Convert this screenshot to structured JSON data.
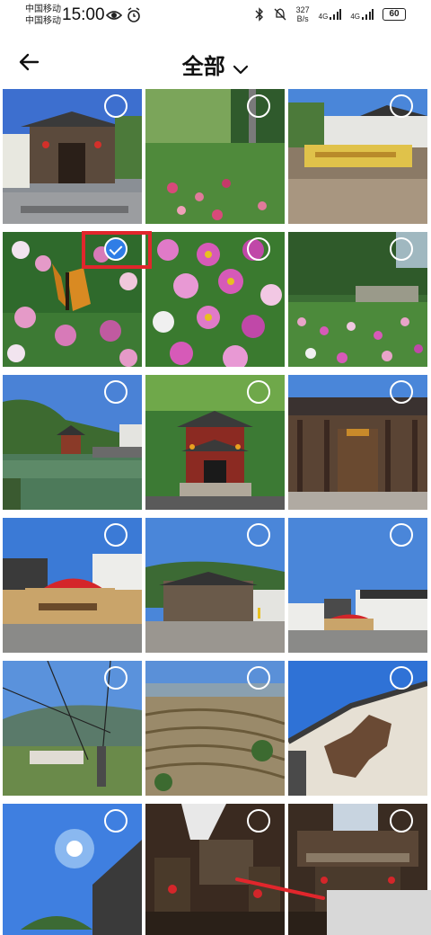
{
  "status_bar": {
    "carrier_1": "中国移动",
    "carrier_2": "中国移动",
    "time": "15:00",
    "speed_value": "327",
    "speed_unit": "B/s",
    "network_1": "4G",
    "network_2": "4G",
    "battery": "60"
  },
  "header": {
    "title": "全部"
  },
  "photos": [
    {
      "name": "village-gate",
      "selected": false
    },
    {
      "name": "garden-path",
      "selected": false
    },
    {
      "name": "stone-plaque",
      "selected": false
    },
    {
      "name": "butterfly-cosmos",
      "selected": true
    },
    {
      "name": "cosmos-flowers",
      "selected": false
    },
    {
      "name": "flower-field",
      "selected": false
    },
    {
      "name": "lake-pavilion",
      "selected": false
    },
    {
      "name": "pavilion-gate",
      "selected": false
    },
    {
      "name": "ancestral-hall",
      "selected": false
    },
    {
      "name": "stage-red-arch",
      "selected": false
    },
    {
      "name": "square-buildings",
      "selected": false
    },
    {
      "name": "village-houses",
      "selected": false
    },
    {
      "name": "cable-car-view",
      "selected": false
    },
    {
      "name": "terraced-fields",
      "selected": false
    },
    {
      "name": "wall-map",
      "selected": false
    },
    {
      "name": "sun-sky",
      "selected": false
    },
    {
      "name": "interior-courtyard",
      "selected": false
    },
    {
      "name": "interior-balcony",
      "selected": false
    }
  ],
  "colors": {
    "accent": "#2f7de6",
    "highlight": "#e1262c"
  }
}
